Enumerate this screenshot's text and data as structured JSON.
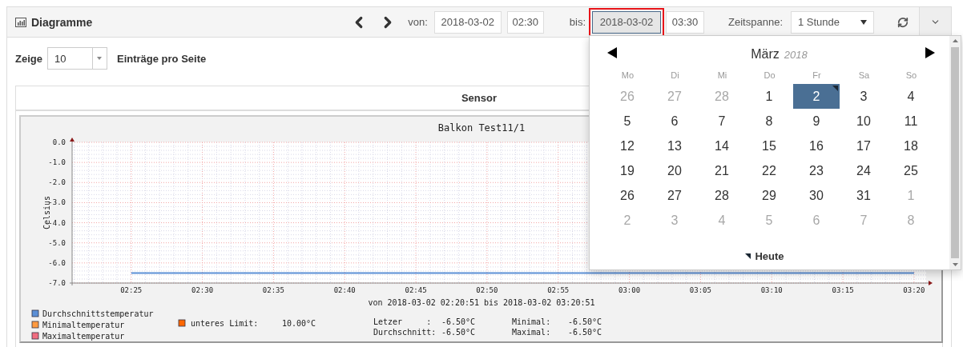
{
  "panel": {
    "title": "Diagramme"
  },
  "toolbar": {
    "von_label": "von:",
    "von_date": {
      "value": "2018-03-02",
      "focused": false
    },
    "von_time": {
      "value": "02:30",
      "focused": false
    },
    "bis_label": "bis:",
    "bis_date": {
      "value": "2018-03-02",
      "focused": true
    },
    "bis_time": {
      "value": "03:30",
      "focused": false
    },
    "span_label": "Zeitspanne:",
    "span_select": {
      "value": "1 Stunde"
    }
  },
  "page_length": {
    "label_before": "Zeige",
    "value": "10",
    "label_after": "Einträge pro Seite"
  },
  "table": {
    "columns": [
      "Sensor"
    ]
  },
  "chart": {
    "title": "Balkon Test11/1",
    "range": "von 2018-03-02 02:20:51 bis 2018-03-02 03:20:51",
    "legend": [
      {
        "label": "Minimaltemperatur",
        "color": "#ff9a40"
      },
      {
        "label": "Maximaltemperatur",
        "color": "#f06d80"
      }
    ],
    "limit": {
      "label": "unteres Limit:",
      "value": "10.00°C",
      "color": "#ff6600"
    },
    "stats": [
      {
        "label": "Letzer     :",
        "value": "-6.50°C"
      },
      {
        "label": "Minimal:",
        "value": "-6.50°C"
      },
      {
        "label": "Durchschnitt:",
        "value": "-6.50°C"
      },
      {
        "label": "Maximal:",
        "value": "-6.50°C"
      }
    ],
    "chart_data": {
      "type": "line",
      "ylabel": "Celsius",
      "ylim": [
        -7,
        0
      ],
      "grid": true,
      "categories": [
        "02:25",
        "02:30",
        "02:35",
        "02:40",
        "02:45",
        "02:50",
        "02:55",
        "03:00",
        "03:05",
        "03:10",
        "03:15",
        "03:20"
      ],
      "yticks": [
        {
          "value": 0,
          "label": "0.0"
        },
        {
          "value": -1,
          "label": "-1.0"
        },
        {
          "value": -2,
          "label": "-2.0"
        },
        {
          "value": -3,
          "label": "-3.0"
        },
        {
          "value": -4,
          "label": "-4.0"
        },
        {
          "value": -5,
          "label": "-5.0"
        },
        {
          "value": -6,
          "label": "-6.0"
        },
        {
          "value": -7,
          "label": "-7.0"
        }
      ],
      "series": [
        {
          "name": "Durchschnittstemperatur",
          "color": "#5b8fd6",
          "values": [
            -6.5,
            -6.5,
            -6.5,
            -6.5,
            -6.5,
            -6.5,
            -6.5,
            -6.5,
            -6.5,
            -6.5,
            -6.5,
            -6.5
          ]
        }
      ]
    }
  },
  "calendar": {
    "month": "März",
    "year": "2018",
    "weekdays": [
      "Mo",
      "Di",
      "Mi",
      "Do",
      "Fr",
      "Sa",
      "So"
    ],
    "days": [
      {
        "label": "26",
        "muted": true,
        "selected": false,
        "today": false
      },
      {
        "label": "27",
        "muted": true,
        "selected": false,
        "today": false
      },
      {
        "label": "28",
        "muted": true,
        "selected": false,
        "today": false
      },
      {
        "label": "1",
        "muted": false,
        "selected": false,
        "today": false
      },
      {
        "label": "2",
        "muted": false,
        "selected": true,
        "today": true
      },
      {
        "label": "3",
        "muted": false,
        "selected": false,
        "today": false
      },
      {
        "label": "4",
        "muted": false,
        "selected": false,
        "today": false
      },
      {
        "label": "5",
        "muted": false,
        "selected": false,
        "today": false
      },
      {
        "label": "6",
        "muted": false,
        "selected": false,
        "today": false
      },
      {
        "label": "7",
        "muted": false,
        "selected": false,
        "today": false
      },
      {
        "label": "8",
        "muted": false,
        "selected": false,
        "today": false
      },
      {
        "label": "9",
        "muted": false,
        "selected": false,
        "today": false
      },
      {
        "label": "10",
        "muted": false,
        "selected": false,
        "today": false
      },
      {
        "label": "11",
        "muted": false,
        "selected": false,
        "today": false
      },
      {
        "label": "12",
        "muted": false,
        "selected": false,
        "today": false
      },
      {
        "label": "13",
        "muted": false,
        "selected": false,
        "today": false
      },
      {
        "label": "14",
        "muted": false,
        "selected": false,
        "today": false
      },
      {
        "label": "15",
        "muted": false,
        "selected": false,
        "today": false
      },
      {
        "label": "16",
        "muted": false,
        "selected": false,
        "today": false
      },
      {
        "label": "17",
        "muted": false,
        "selected": false,
        "today": false
      },
      {
        "label": "18",
        "muted": false,
        "selected": false,
        "today": false
      },
      {
        "label": "19",
        "muted": false,
        "selected": false,
        "today": false
      },
      {
        "label": "20",
        "muted": false,
        "selected": false,
        "today": false
      },
      {
        "label": "21",
        "muted": false,
        "selected": false,
        "today": false
      },
      {
        "label": "22",
        "muted": false,
        "selected": false,
        "today": false
      },
      {
        "label": "23",
        "muted": false,
        "selected": false,
        "today": false
      },
      {
        "label": "24",
        "muted": false,
        "selected": false,
        "today": false
      },
      {
        "label": "25",
        "muted": false,
        "selected": false,
        "today": false
      },
      {
        "label": "26",
        "muted": false,
        "selected": false,
        "today": false
      },
      {
        "label": "27",
        "muted": false,
        "selected": false,
        "today": false
      },
      {
        "label": "28",
        "muted": false,
        "selected": false,
        "today": false
      },
      {
        "label": "29",
        "muted": false,
        "selected": false,
        "today": false
      },
      {
        "label": "30",
        "muted": false,
        "selected": false,
        "today": false
      },
      {
        "label": "31",
        "muted": false,
        "selected": false,
        "today": false
      },
      {
        "label": "1",
        "muted": true,
        "selected": false,
        "today": false
      },
      {
        "label": "2",
        "muted": true,
        "selected": false,
        "today": false
      },
      {
        "label": "3",
        "muted": true,
        "selected": false,
        "today": false
      },
      {
        "label": "4",
        "muted": true,
        "selected": false,
        "today": false
      },
      {
        "label": "5",
        "muted": true,
        "selected": false,
        "today": false
      },
      {
        "label": "6",
        "muted": true,
        "selected": false,
        "today": false
      },
      {
        "label": "7",
        "muted": true,
        "selected": false,
        "today": false
      },
      {
        "label": "8",
        "muted": true,
        "selected": false,
        "today": false
      }
    ],
    "today_button": "Heute"
  }
}
